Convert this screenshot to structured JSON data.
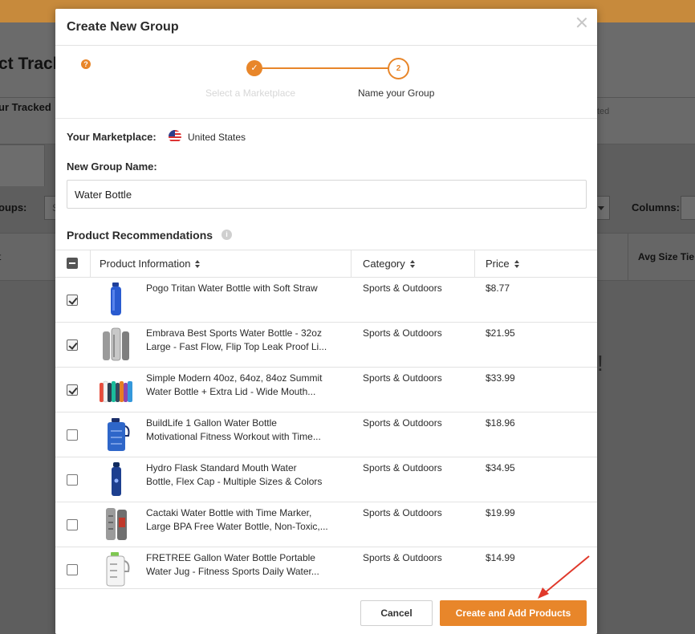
{
  "background": {
    "title": "ct Track",
    "subtitle": "ur Tracked",
    "right_muted": "ted",
    "groups_label": "oups:",
    "groups_input_hint": "S",
    "columns_label": "Columns:",
    "col_header_right": "Avg Size Tie",
    "col_header_left": "t",
    "exclamation": "!"
  },
  "modal": {
    "title": "Create New Group",
    "stepper": {
      "step1_label": "Select a Marketplace",
      "step1_mark": "✓",
      "step2_number": "2",
      "step2_label": "Name your Group"
    },
    "help_glyph": "?",
    "marketplace": {
      "label": "Your Marketplace:",
      "value": "United States"
    },
    "group_name": {
      "label": "New Group Name:",
      "value": "Water Bottle"
    },
    "recommendations_label": "Product Recommendations",
    "info_glyph": "i",
    "table": {
      "headers": {
        "product": "Product Information",
        "category": "Category",
        "price": "Price"
      },
      "rows": [
        {
          "checked": true,
          "name1": "Pogo Tritan Water Bottle with Soft Straw",
          "name2": "",
          "category": "Sports & Outdoors",
          "price": "$8.77",
          "thumb": "single-blue-bottle"
        },
        {
          "checked": true,
          "name1": "Embrava Best Sports Water Bottle - 32oz",
          "name2": "Large - Fast Flow, Flip Top Leak Proof Li...",
          "category": "Sports & Outdoors",
          "price": "$21.95",
          "thumb": "grey-bottles-group"
        },
        {
          "checked": true,
          "name1": "Simple Modern 40oz, 64oz, 84oz Summit",
          "name2": "Water Bottle + Extra Lid - Wide Mouth...",
          "category": "Sports & Outdoors",
          "price": "$33.99",
          "thumb": "colorful-bottles-row"
        },
        {
          "checked": false,
          "name1": "BuildLife 1 Gallon Water Bottle",
          "name2": "Motivational Fitness Workout with Time...",
          "category": "Sports & Outdoors",
          "price": "$18.96",
          "thumb": "blue-gallon-jug"
        },
        {
          "checked": false,
          "name1": "Hydro Flask Standard Mouth Water",
          "name2": "Bottle, Flex Cap - Multiple Sizes & Colors",
          "category": "Sports & Outdoors",
          "price": "$34.95",
          "thumb": "navy-flask"
        },
        {
          "checked": false,
          "name1": "Cactaki Water Bottle with Time Marker,",
          "name2": "Large BPA Free Water Bottle, Non-Toxic,...",
          "category": "Sports & Outdoors",
          "price": "$19.99",
          "thumb": "marker-bottles-pair"
        },
        {
          "checked": false,
          "name1": "FRETREE Gallon Water Bottle Portable",
          "name2": "Water Jug - Fitness Sports Daily Water...",
          "category": "Sports & Outdoors",
          "price": "$14.99",
          "thumb": "clear-gallon-jug"
        }
      ]
    },
    "buttons": {
      "cancel": "Cancel",
      "create": "Create and Add Products"
    }
  },
  "colors": {
    "accent": "#e8862a",
    "annotation_arrow": "#e0392b"
  }
}
